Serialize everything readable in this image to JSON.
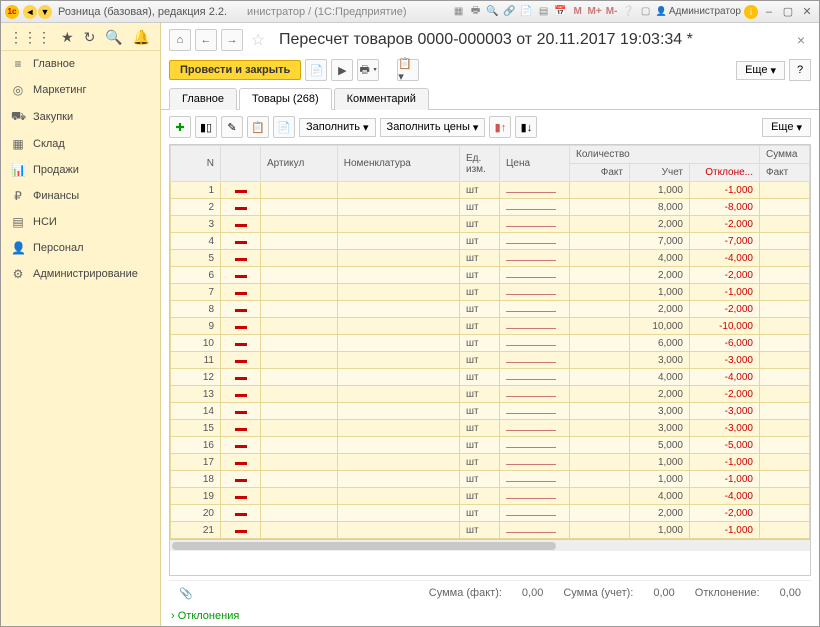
{
  "titlebar": {
    "app_title": "Розница (базовая), редакция 2.2.",
    "breadcrumb": "инистратор /  (1С:Предприятие)",
    "admin": "Администратор"
  },
  "sidebar": {
    "items": [
      {
        "icon": "≡",
        "label": "Главное"
      },
      {
        "icon": "◎",
        "label": "Маркетинг"
      },
      {
        "icon": "⛟",
        "label": "Закупки"
      },
      {
        "icon": "▦",
        "label": "Склад"
      },
      {
        "icon": "📊",
        "label": "Продажи"
      },
      {
        "icon": "₽",
        "label": "Финансы"
      },
      {
        "icon": "▤",
        "label": "НСИ"
      },
      {
        "icon": "👤",
        "label": "Персонал"
      },
      {
        "icon": "⚙",
        "label": "Администрирование"
      }
    ]
  },
  "doc": {
    "title": "Пересчет товаров 0000-000003 от 20.11.2017 19:03:34 *",
    "btn_save": "Провести и закрыть",
    "btn_more": "Еще",
    "tabs": [
      "Главное",
      "Товары (268)",
      "Комментарий"
    ],
    "btn_fill": "Заполнить",
    "btn_fill_prices": "Заполнить цены"
  },
  "grid": {
    "headers": {
      "n": "N",
      "article": "Артикул",
      "nom": "Номенклатура",
      "unit": "Ед. изм.",
      "price": "Цена",
      "qty": "Количество",
      "fact": "Факт",
      "account": "Учет",
      "dev": "Отклоне...",
      "sum": "Сумма",
      "sum_fact": "Факт"
    },
    "rows": [
      {
        "n": 1,
        "unit": "шт",
        "account": "1,000",
        "dev": "-1,000"
      },
      {
        "n": 2,
        "unit": "шт",
        "account": "8,000",
        "dev": "-8,000"
      },
      {
        "n": 3,
        "unit": "шт",
        "account": "2,000",
        "dev": "-2,000"
      },
      {
        "n": 4,
        "unit": "шт",
        "account": "7,000",
        "dev": "-7,000"
      },
      {
        "n": 5,
        "unit": "шт",
        "account": "4,000",
        "dev": "-4,000"
      },
      {
        "n": 6,
        "unit": "шт",
        "account": "2,000",
        "dev": "-2,000"
      },
      {
        "n": 7,
        "unit": "шт",
        "account": "1,000",
        "dev": "-1,000"
      },
      {
        "n": 8,
        "unit": "шт",
        "account": "2,000",
        "dev": "-2,000"
      },
      {
        "n": 9,
        "unit": "шт",
        "account": "10,000",
        "dev": "-10,000"
      },
      {
        "n": 10,
        "unit": "шт",
        "account": "6,000",
        "dev": "-6,000"
      },
      {
        "n": 11,
        "unit": "шт",
        "account": "3,000",
        "dev": "-3,000"
      },
      {
        "n": 12,
        "unit": "шт",
        "account": "4,000",
        "dev": "-4,000"
      },
      {
        "n": 13,
        "unit": "шт",
        "account": "2,000",
        "dev": "-2,000"
      },
      {
        "n": 14,
        "unit": "шт",
        "account": "3,000",
        "dev": "-3,000"
      },
      {
        "n": 15,
        "unit": "шт",
        "account": "3,000",
        "dev": "-3,000"
      },
      {
        "n": 16,
        "unit": "шт",
        "account": "5,000",
        "dev": "-5,000"
      },
      {
        "n": 17,
        "unit": "шт",
        "account": "1,000",
        "dev": "-1,000"
      },
      {
        "n": 18,
        "unit": "шт",
        "account": "1,000",
        "dev": "-1,000"
      },
      {
        "n": 19,
        "unit": "шт",
        "account": "4,000",
        "dev": "-4,000"
      },
      {
        "n": 20,
        "unit": "шт",
        "account": "2,000",
        "dev": "-2,000"
      },
      {
        "n": 21,
        "unit": "шт",
        "account": "1,000",
        "dev": "-1,000"
      }
    ]
  },
  "footer": {
    "sum_fact_label": "Сумма (факт):",
    "sum_fact_val": "0,00",
    "sum_acc_label": "Сумма (учет):",
    "sum_acc_val": "0,00",
    "dev_label": "Отклонение:",
    "dev_val": "0,00",
    "deviations": "Отклонения"
  }
}
